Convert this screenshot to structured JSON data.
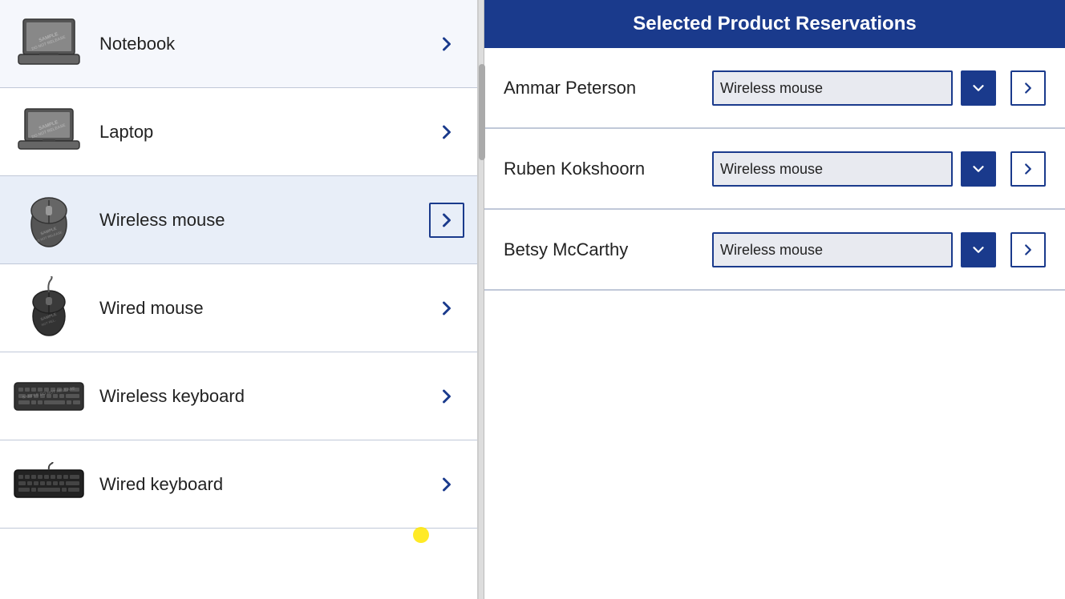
{
  "header": {
    "title": "Selected Product Reservations"
  },
  "left_panel": {
    "products": [
      {
        "id": "notebook",
        "label": "Notebook",
        "active": false
      },
      {
        "id": "laptop",
        "label": "Laptop",
        "active": false
      },
      {
        "id": "wireless-mouse",
        "label": "Wireless mouse",
        "active": true
      },
      {
        "id": "wired-mouse",
        "label": "Wired mouse",
        "active": false
      },
      {
        "id": "wireless-keyboard",
        "label": "Wireless keyboard",
        "active": false
      },
      {
        "id": "wired-keyboard",
        "label": "Wired keyboard",
        "active": false
      }
    ]
  },
  "right_panel": {
    "reservations": [
      {
        "id": "ammar",
        "name": "Ammar Peterson",
        "selected_product": "Wireless mouse"
      },
      {
        "id": "ruben",
        "name": "Ruben Kokshoorn",
        "selected_product": "Wireless mouse"
      },
      {
        "id": "betsy",
        "name": "Betsy McCarthy",
        "selected_product": "Wireless mouse"
      }
    ],
    "product_options": [
      "Notebook",
      "Laptop",
      "Wireless mouse",
      "Wired mouse",
      "Wireless keyboard",
      "Wired keyboard"
    ]
  },
  "icons": {
    "chevron_right": "›",
    "dropdown_arrow": "▼",
    "nav_arrow": "›"
  }
}
